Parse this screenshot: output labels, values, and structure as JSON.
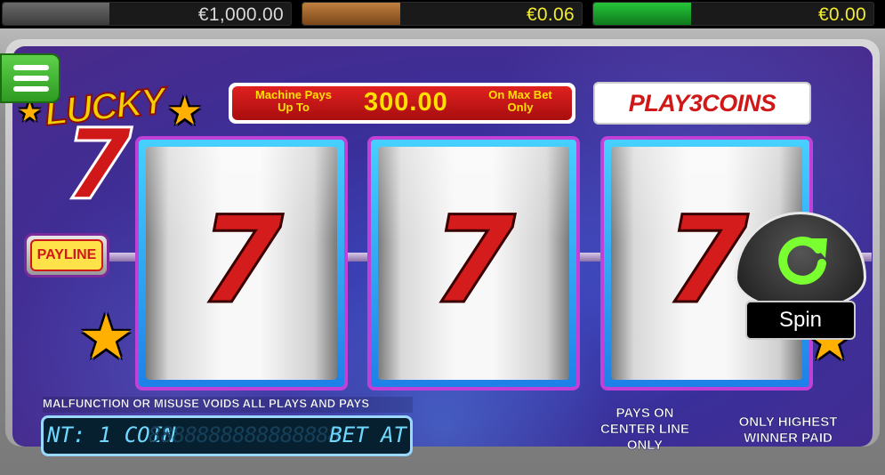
{
  "top_bar": {
    "balance": "€1,000.00",
    "bet": "€0.06",
    "win": "€0.00"
  },
  "logo": {
    "word": "LUCKY",
    "number": "7"
  },
  "pay_sign": {
    "left": "Machine Pays Up To",
    "amount": "300.00",
    "right": "On Max Bet Only"
  },
  "play_coins": "PLAY3COINS",
  "payline_label": "PAYLINE",
  "reels": [
    {
      "symbol": "7"
    },
    {
      "symbol": "7"
    },
    {
      "symbol": "7"
    }
  ],
  "spin": {
    "label": "Spin"
  },
  "notice": "MALFUNCTION OR MISUSE VOIDS ALL PLAYS AND PAYS",
  "lcd": {
    "left": "NT: 1 COIN",
    "ghost": "8888888888888888",
    "right": "BET AT"
  },
  "pays_on_center": "PAYS ON CENTER LINE ONLY",
  "only_highest": "ONLY HIGHEST WINNER PAID",
  "colors": {
    "accent_green": "#2e9a22",
    "sign_red": "#d01818",
    "amount_yellow": "#ffe000",
    "meter_yellow": "#f3ec2e",
    "panel_purple": "#3a2f9a"
  }
}
